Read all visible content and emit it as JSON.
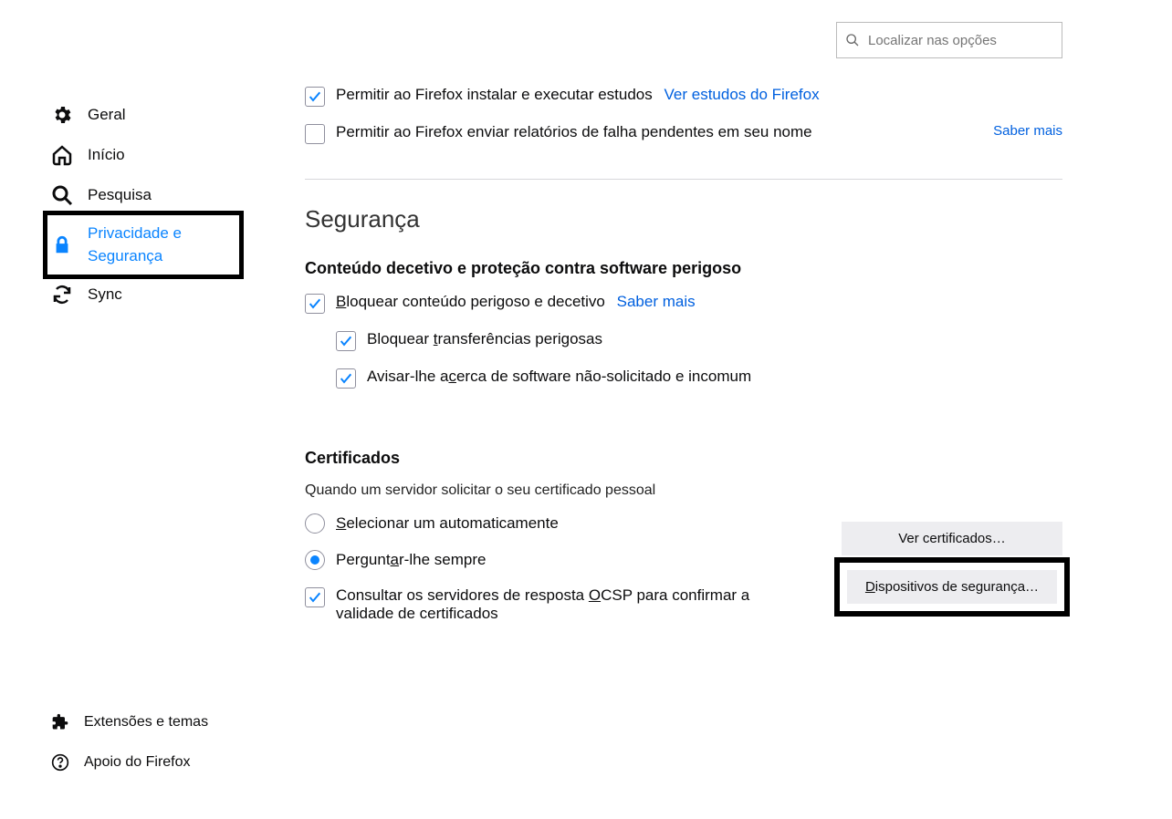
{
  "search": {
    "placeholder": "Localizar nas opções"
  },
  "sidebar": {
    "items": [
      {
        "label": "Geral"
      },
      {
        "label": "Início"
      },
      {
        "label": "Pesquisa"
      },
      {
        "label": "Privacidade e",
        "label2": "Segurança"
      },
      {
        "label": "Sync"
      }
    ]
  },
  "sidebar_bottom": {
    "extensions": "Extensões e temas",
    "support": "Apoio do Firefox"
  },
  "data_collection": {
    "allow_studies": "Permitir ao Firefox instalar e executar estudos",
    "view_studies": "Ver estudos do Firefox",
    "allow_crash": "Permitir ao Firefox enviar relatórios de falha pendentes em seu nome",
    "learn_more": "Saber mais"
  },
  "security": {
    "title": "Segurança",
    "deceptive": {
      "heading": "Conteúdo decetivo e proteção contra software perigoso",
      "block_dangerous_pre": "B",
      "block_dangerous_post": "loquear conteúdo perigoso e decetivo",
      "learn_more": "Saber mais",
      "block_downloads_pre": "Bloquear ",
      "block_downloads_u": "t",
      "block_downloads_post": "ransferências perigosas",
      "warn_unwanted_pre": "Avisar-lhe a",
      "warn_unwanted_u": "c",
      "warn_unwanted_post": "erca de software não-solicitado e incomum"
    },
    "certs": {
      "heading": "Certificados",
      "subtext": "Quando um servidor solicitar o seu certificado pessoal",
      "radio_auto_pre": "S",
      "radio_auto_post": "elecionar um automaticamente",
      "radio_ask_pre": "Pergunt",
      "radio_ask_u": "a",
      "radio_ask_post": "r-lhe sempre",
      "ocsp_pre": "Consultar os servidores de resposta ",
      "ocsp_u": "O",
      "ocsp_mid": "CSP para confirmar a validade de certificados",
      "btn_view": "Ver certificados…",
      "btn_devices_pre": "D",
      "btn_devices_post": "ispositivos de segurança…"
    }
  }
}
